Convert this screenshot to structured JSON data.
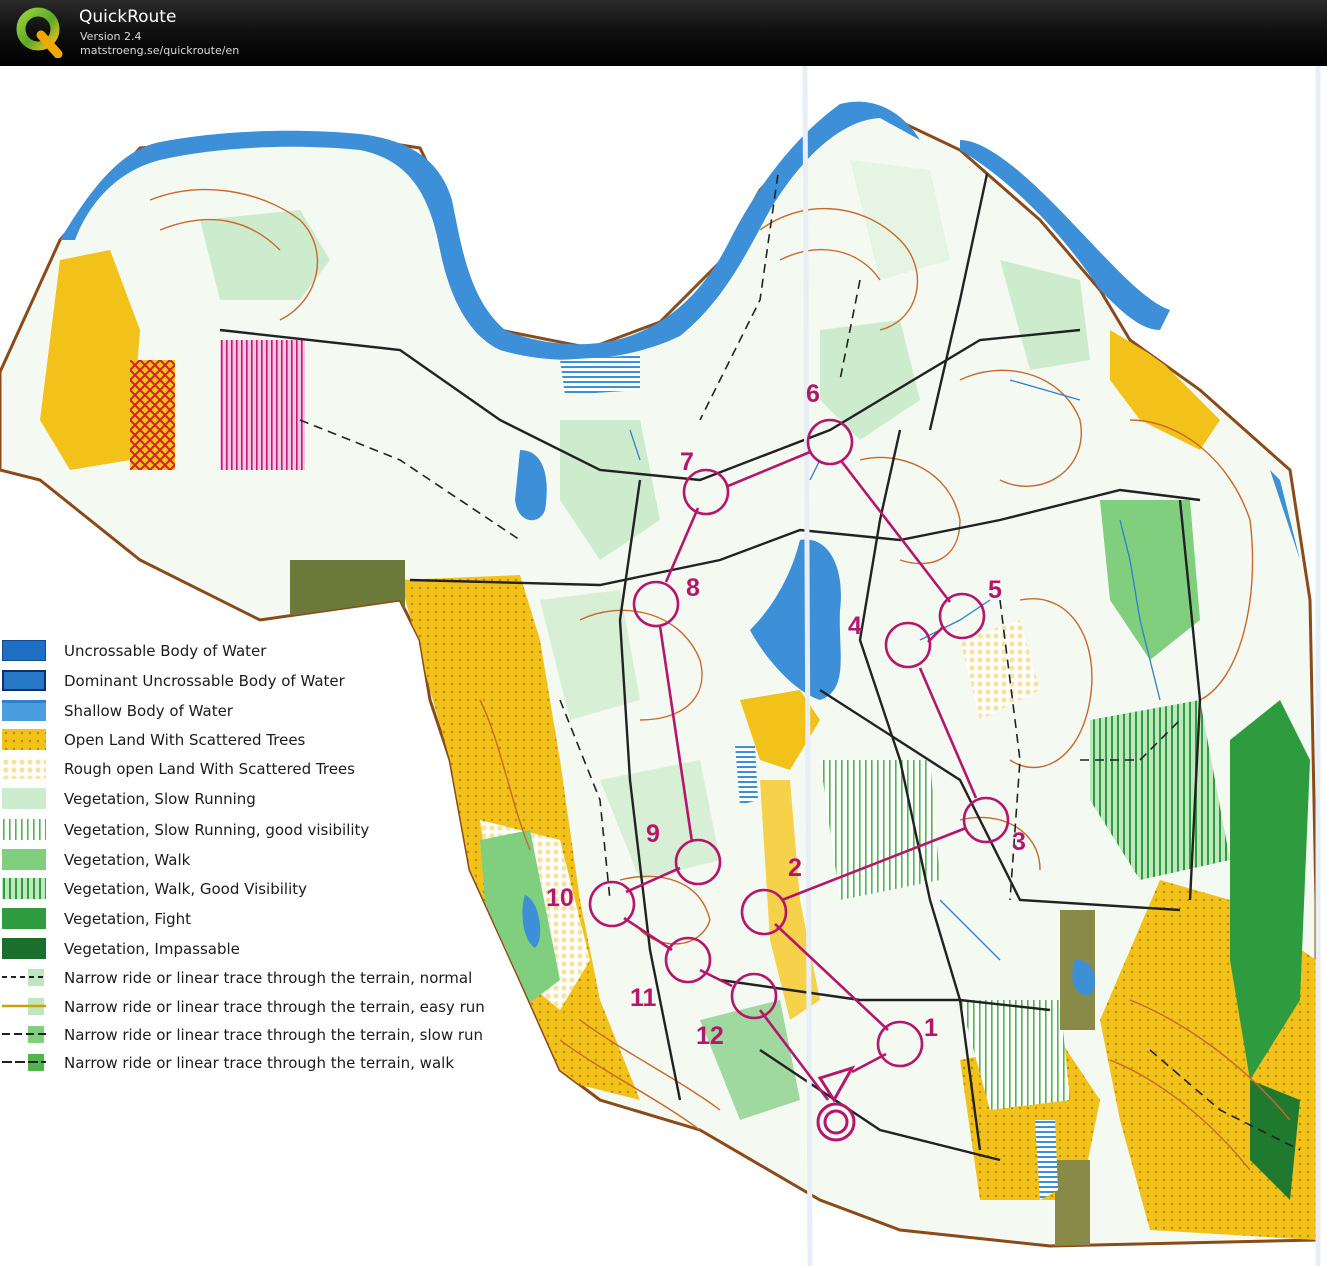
{
  "app": {
    "title": "QuickRoute",
    "version": "Version 2.4",
    "url": "matstroeng.se/quickroute/en",
    "logo_icon": "quickroute-q-logo-icon"
  },
  "colors": {
    "course": "#b5166c",
    "water": "#2f8fd6",
    "open_land": "#f2c200",
    "vegetation": "#7fcf7f",
    "contour": "#c8692b"
  },
  "legend": [
    {
      "label": "Uncrossable Body of Water",
      "symbol": "water-dark"
    },
    {
      "label": "Dominant Uncrossable Body of Water",
      "symbol": "water-dominant"
    },
    {
      "label": "Shallow Body of Water",
      "symbol": "water-shallow"
    },
    {
      "label": "Open Land With Scattered Trees",
      "symbol": "open-scattered"
    },
    {
      "label": "Rough open Land With Scattered Trees",
      "symbol": "rough-scattered"
    },
    {
      "label": "Vegetation, Slow Running",
      "symbol": "veg-slow"
    },
    {
      "label": "Vegetation, Slow Running, good visibility",
      "symbol": "veg-slow-vis"
    },
    {
      "label": "Vegetation, Walk",
      "symbol": "veg-walk"
    },
    {
      "label": "Vegetation, Walk, Good Visibility",
      "symbol": "veg-walk-vis"
    },
    {
      "label": "Vegetation, Fight",
      "symbol": "veg-fight"
    },
    {
      "label": "Vegetation, Impassable",
      "symbol": "veg-impassable"
    },
    {
      "label": "Narrow ride or linear trace through the terrain, normal",
      "symbol": "trace-normal"
    },
    {
      "label": "Narrow ride or linear trace through the terrain, easy run",
      "symbol": "trace-easy"
    },
    {
      "label": "Narrow ride or linear trace through the terrain, slow run",
      "symbol": "trace-slow"
    },
    {
      "label": "Narrow ride or linear trace through the terrain, walk",
      "symbol": "trace-walk"
    }
  ],
  "course": {
    "controls": [
      "1",
      "2",
      "3",
      "4",
      "5",
      "6",
      "7",
      "8",
      "9",
      "10",
      "11",
      "12"
    ]
  }
}
